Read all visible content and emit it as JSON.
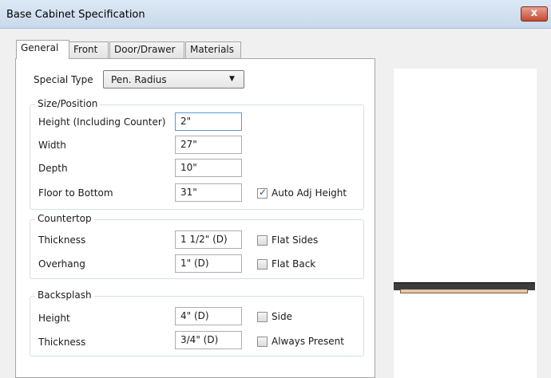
{
  "window": {
    "title": "Base Cabinet Specification",
    "close_label": "x"
  },
  "tabs": [
    {
      "label": "General",
      "active": true
    },
    {
      "label": "Front",
      "active": false
    },
    {
      "label": "Door/Drawer",
      "active": false
    },
    {
      "label": "Materials",
      "active": false
    }
  ],
  "special_type": {
    "label": "Special Type",
    "value": "Pen. Radius"
  },
  "size_position": {
    "title": "Size/Position",
    "height": {
      "label": "Height (Including Counter)",
      "value": "2\""
    },
    "width": {
      "label": "Width",
      "value": "27\""
    },
    "depth": {
      "label": "Depth",
      "value": "10\""
    },
    "floor_to_bottom": {
      "label": "Floor to Bottom",
      "value": "31\""
    },
    "auto_adj_height": {
      "label": "Auto Adj Height",
      "checked": true
    }
  },
  "countertop": {
    "title": "Countertop",
    "thickness": {
      "label": "Thickness",
      "value": "1 1/2\" (D)"
    },
    "overhang": {
      "label": "Overhang",
      "value": "1\" (D)"
    },
    "flat_sides": {
      "label": "Flat Sides",
      "checked": false
    },
    "flat_back": {
      "label": "Flat Back",
      "checked": false
    }
  },
  "backsplash": {
    "title": "Backsplash",
    "height": {
      "label": "Height",
      "value": "4\" (D)"
    },
    "thickness": {
      "label": "Thickness",
      "value": "3/4\" (D)"
    },
    "side": {
      "label": "Side",
      "checked": false
    },
    "always_present": {
      "label": "Always Present",
      "checked": false
    }
  }
}
